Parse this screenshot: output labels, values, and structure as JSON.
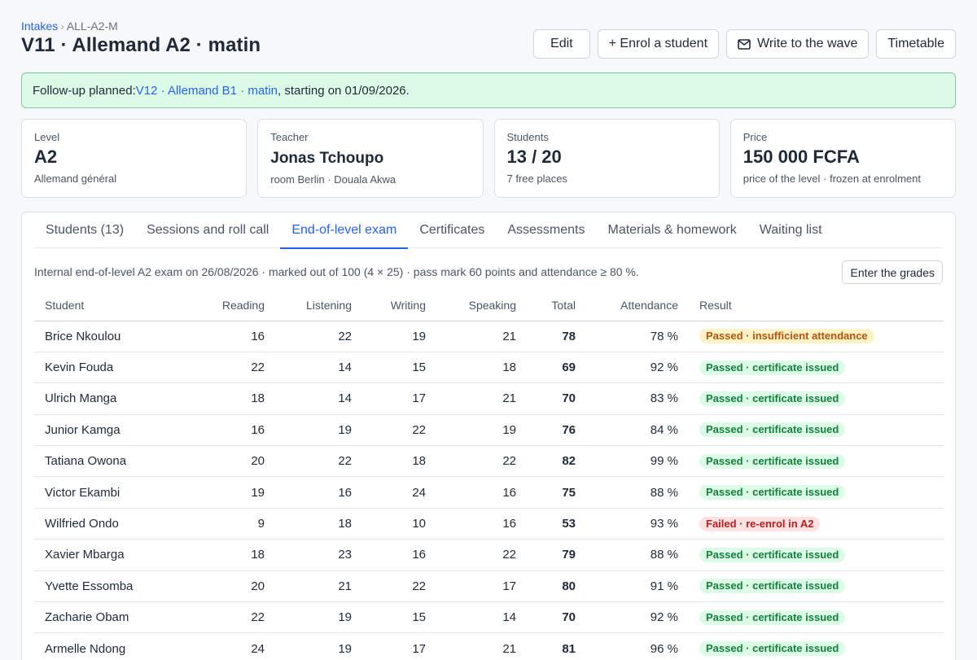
{
  "breadcrumb": {
    "parent": "Intakes",
    "separator": "›",
    "current": "ALL-A2-M"
  },
  "page_title": "V11 · Allemand A2 · matin",
  "actions": {
    "edit": "Edit",
    "enrol": "+ Enrol a student",
    "write": "Write to the wave",
    "timetable": "Timetable"
  },
  "banner": {
    "prefix": "Follow-up planned: ",
    "link": "V12 · Allemand B1 · matin",
    "suffix": ", starting on 01/09/2026."
  },
  "cards": [
    {
      "label": "Level",
      "value": "A2",
      "sub": "Allemand général"
    },
    {
      "label": "Teacher",
      "value": "Jonas Tchoupo",
      "sub": "room Berlin · Douala Akwa"
    },
    {
      "label": "Students",
      "value": "13 / 20",
      "sub": "7 free places"
    },
    {
      "label": "Price",
      "value": "150 000 FCFA",
      "sub": "price of the level · frozen at enrolment"
    }
  ],
  "tabs": [
    {
      "label": "Students (13)"
    },
    {
      "label": "Sessions and roll call"
    },
    {
      "label": "End-of-level exam"
    },
    {
      "label": "Certificates"
    },
    {
      "label": "Assessments"
    },
    {
      "label": "Materials & homework"
    },
    {
      "label": "Waiting list"
    }
  ],
  "active_tab": 2,
  "exam": {
    "info": "Internal end-of-level A2 exam on 26/08/2026 · marked out of 100 (4 × 25) · pass mark 60 points and attendance ≥ 80 %.",
    "enter_grades": "Enter the grades"
  },
  "table": {
    "headers": {
      "student": "Student",
      "reading": "Reading",
      "listening": "Listening",
      "writing": "Writing",
      "speaking": "Speaking",
      "total": "Total",
      "attendance": "Attendance",
      "result": "Result"
    },
    "rows": [
      {
        "name": "Brice Nkoulou",
        "reading": "16",
        "listening": "22",
        "writing": "19",
        "speaking": "21",
        "total": "78",
        "attendance": "78 %",
        "result": "Passed · insufficient attendance",
        "status": "warn"
      },
      {
        "name": "Kevin Fouda",
        "reading": "22",
        "listening": "14",
        "writing": "15",
        "speaking": "18",
        "total": "69",
        "attendance": "92 %",
        "result": "Passed · certificate issued",
        "status": "ok"
      },
      {
        "name": "Ulrich Manga",
        "reading": "18",
        "listening": "14",
        "writing": "17",
        "speaking": "21",
        "total": "70",
        "attendance": "83 %",
        "result": "Passed · certificate issued",
        "status": "ok"
      },
      {
        "name": "Junior Kamga",
        "reading": "16",
        "listening": "19",
        "writing": "22",
        "speaking": "19",
        "total": "76",
        "attendance": "84 %",
        "result": "Passed · certificate issued",
        "status": "ok"
      },
      {
        "name": "Tatiana Owona",
        "reading": "20",
        "listening": "22",
        "writing": "18",
        "speaking": "22",
        "total": "82",
        "attendance": "99 %",
        "result": "Passed · certificate issued",
        "status": "ok"
      },
      {
        "name": "Victor Ekambi",
        "reading": "19",
        "listening": "16",
        "writing": "24",
        "speaking": "16",
        "total": "75",
        "attendance": "88 %",
        "result": "Passed · certificate issued",
        "status": "ok"
      },
      {
        "name": "Wilfried Ondo",
        "reading": "9",
        "listening": "18",
        "writing": "10",
        "speaking": "16",
        "total": "53",
        "attendance": "93 %",
        "result": "Failed · re-enrol in A2",
        "status": "fail"
      },
      {
        "name": "Xavier Mbarga",
        "reading": "18",
        "listening": "23",
        "writing": "16",
        "speaking": "22",
        "total": "79",
        "attendance": "88 %",
        "result": "Passed · certificate issued",
        "status": "ok"
      },
      {
        "name": "Yvette Essomba",
        "reading": "20",
        "listening": "21",
        "writing": "22",
        "speaking": "17",
        "total": "80",
        "attendance": "91 %",
        "result": "Passed · certificate issued",
        "status": "ok"
      },
      {
        "name": "Zacharie Obam",
        "reading": "22",
        "listening": "19",
        "writing": "15",
        "speaking": "14",
        "total": "70",
        "attendance": "92 %",
        "result": "Passed · certificate issued",
        "status": "ok"
      },
      {
        "name": "Armelle Ndong",
        "reading": "24",
        "listening": "19",
        "writing": "17",
        "speaking": "21",
        "total": "81",
        "attendance": "96 %",
        "result": "Passed · certificate issued",
        "status": "ok"
      }
    ]
  }
}
